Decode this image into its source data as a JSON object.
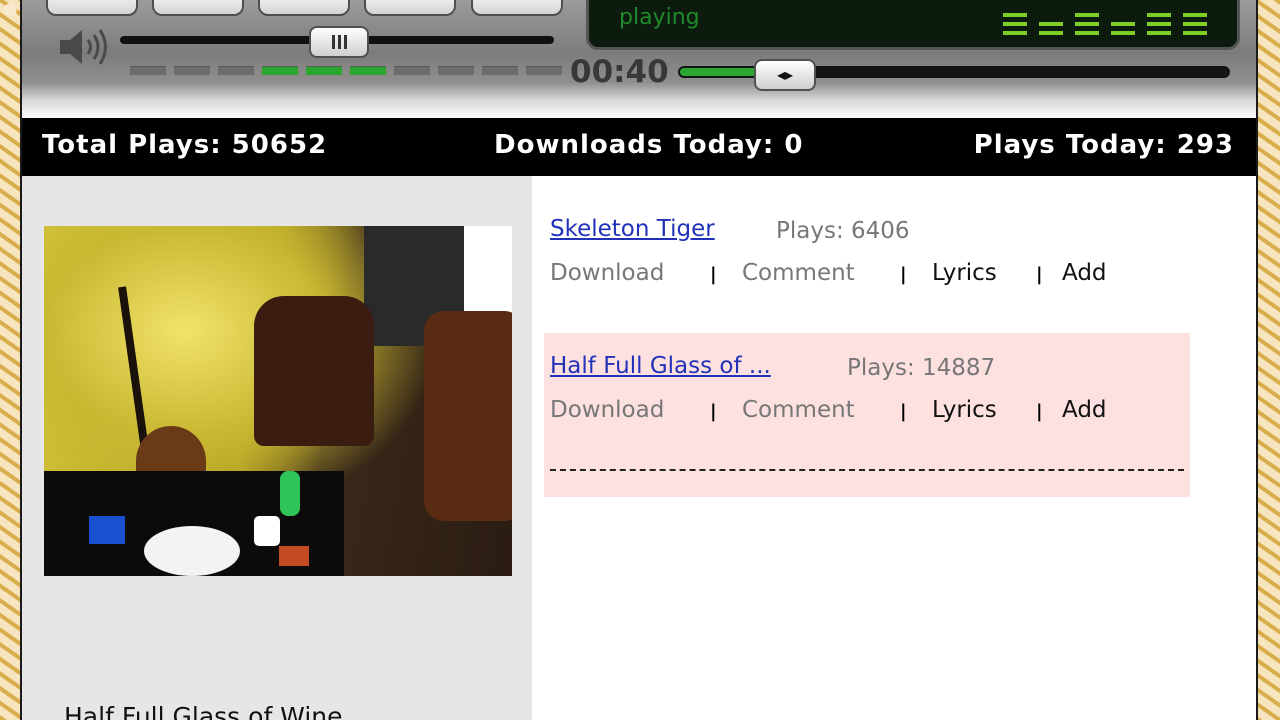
{
  "player": {
    "status": "playing",
    "time": "00:40",
    "volume_percent": 41,
    "seek_percent": 14,
    "level_bars_on": [
      3,
      4,
      5
    ],
    "level_bars_total": 10,
    "seek_thumb_glyph": "◂▸"
  },
  "stats": {
    "total_plays": "Total Plays: 50652",
    "downloads_today": "Downloads Today: 0",
    "plays_today": "Plays Today:  293"
  },
  "now_playing": {
    "caption": "Half Full Glass of Wine"
  },
  "tracks": [
    {
      "title": "Skeleton Tiger",
      "plays": "Plays: 6406",
      "download": "Download",
      "comment": "Comment",
      "lyrics": "Lyrics",
      "add": "Add",
      "highlighted": false
    },
    {
      "title": "Half Full Glass of ...",
      "plays": "Plays: 14887",
      "download": "Download",
      "comment": "Comment",
      "lyrics": "Lyrics",
      "add": "Add",
      "highlighted": true
    }
  ],
  "separator": "|",
  "colors": {
    "accent_green": "#2ba631",
    "link_blue": "#2232b8",
    "highlight_pink": "#fde0e0"
  }
}
